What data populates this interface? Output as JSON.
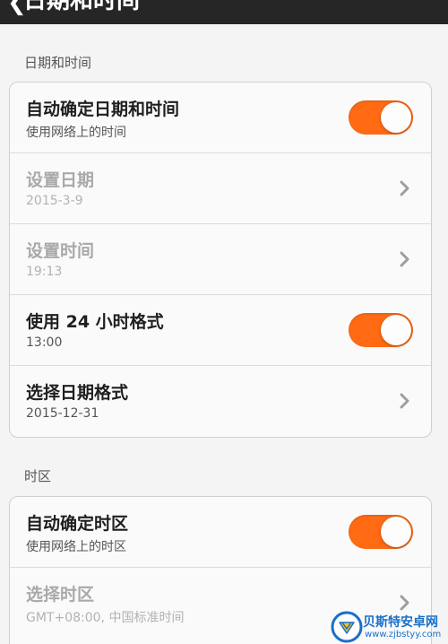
{
  "header": {
    "title": "日期和时间",
    "back_icon": "chevron-left-icon"
  },
  "sections": [
    {
      "header": "日期和时间",
      "rows": [
        {
          "title": "自动确定日期和时间",
          "subtitle": "使用网络上的时间",
          "control": "toggle",
          "toggle_on": true,
          "enabled": true
        },
        {
          "title": "设置日期",
          "subtitle": "2015-3-9",
          "control": "chevron",
          "enabled": false
        },
        {
          "title": "设置时间",
          "subtitle": "19:13",
          "control": "chevron",
          "enabled": false
        },
        {
          "title": "使用 24 小时格式",
          "subtitle": "13:00",
          "control": "toggle",
          "toggle_on": true,
          "enabled": true
        },
        {
          "title": "选择日期格式",
          "subtitle": "2015-12-31",
          "control": "chevron",
          "enabled": true
        }
      ]
    },
    {
      "header": "时区",
      "rows": [
        {
          "title": "自动确定时区",
          "subtitle": "使用网络上的时区",
          "control": "toggle",
          "toggle_on": true,
          "enabled": true
        },
        {
          "title": "选择时区",
          "subtitle": "GMT+08:00, 中国标准时间",
          "control": "chevron",
          "enabled": false
        }
      ]
    }
  ],
  "watermark": {
    "name": "贝斯特安卓网",
    "url": "www.zjbstyy.com"
  },
  "colors": {
    "accent": "#ff6a13",
    "topbar": "#262626",
    "background": "#f4f4f4"
  }
}
